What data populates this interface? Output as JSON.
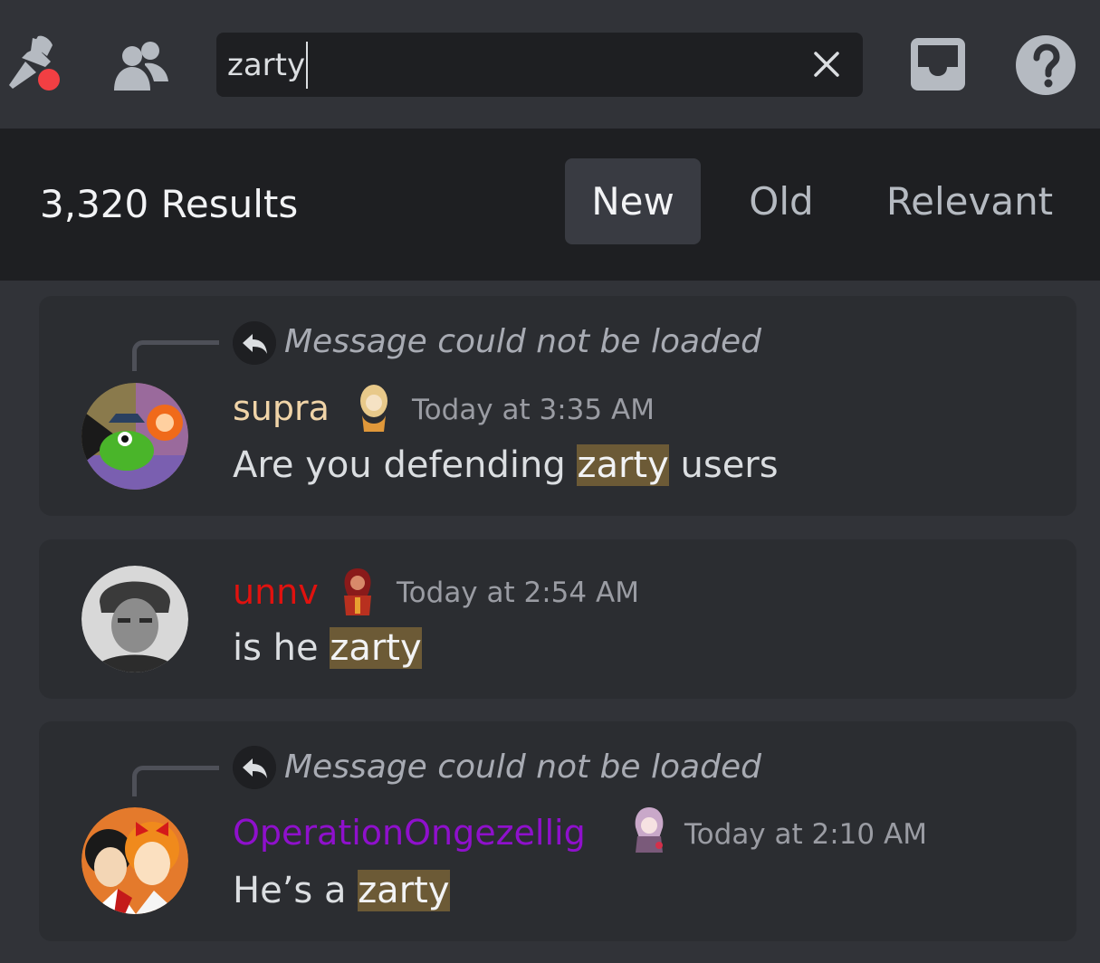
{
  "toolbar": {
    "pin_icon": "pinned-messages-icon",
    "members_icon": "member-list-icon",
    "inbox_icon": "inbox-icon",
    "help_icon": "help-icon"
  },
  "search": {
    "value": "zarty",
    "clear_icon": "close-icon"
  },
  "results": {
    "count_label": "3,320 Results",
    "sort_tabs": [
      {
        "label": "New",
        "active": true
      },
      {
        "label": "Old",
        "active": false
      },
      {
        "label": "Relevant",
        "active": false
      }
    ]
  },
  "messages": [
    {
      "reply_text": "Message could not be loaded",
      "username": "supra",
      "username_color": "#f0d4a8",
      "timestamp": "Today at 3:35 AM",
      "text_before": "Are you defending ",
      "highlight": "zarty",
      "text_after": " users"
    },
    {
      "username": "unnv",
      "username_color": "#e0120f",
      "timestamp": "Today at 2:54 AM",
      "text_before": "is he ",
      "highlight": "zarty",
      "text_after": ""
    },
    {
      "reply_text": "Message could not be loaded",
      "username": "OperationOngezellig",
      "username_color": "#8f10cc",
      "timestamp": "Today at 2:10 AM",
      "text_before": "He’s a ",
      "highlight": "zarty",
      "text_after": ""
    }
  ],
  "colors": {
    "highlight": "#6c5a36",
    "notification_dot": "#f23f43"
  }
}
